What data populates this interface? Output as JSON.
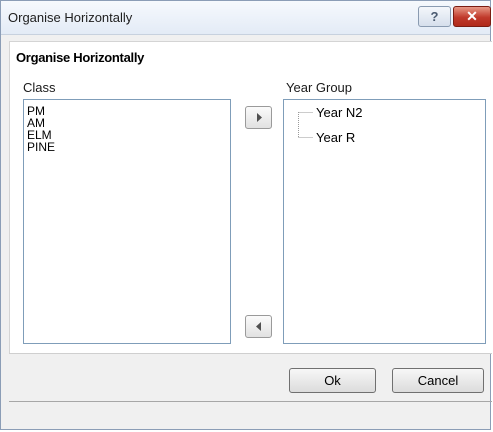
{
  "window": {
    "title": "Organise Horizontally",
    "help_glyph": "?",
    "close_glyph": "✕"
  },
  "form": {
    "heading": "Organise Horizontally"
  },
  "class_list": {
    "label": "Class",
    "items": [
      "PM",
      "AM",
      "ELM",
      "PINE"
    ]
  },
  "year_group": {
    "label": "Year Group",
    "items": [
      "Year N2",
      "Year R"
    ]
  },
  "buttons": {
    "move_right_icon": "arrow-right-icon",
    "move_left_icon": "arrow-left-icon",
    "ok": "Ok",
    "cancel": "Cancel"
  }
}
